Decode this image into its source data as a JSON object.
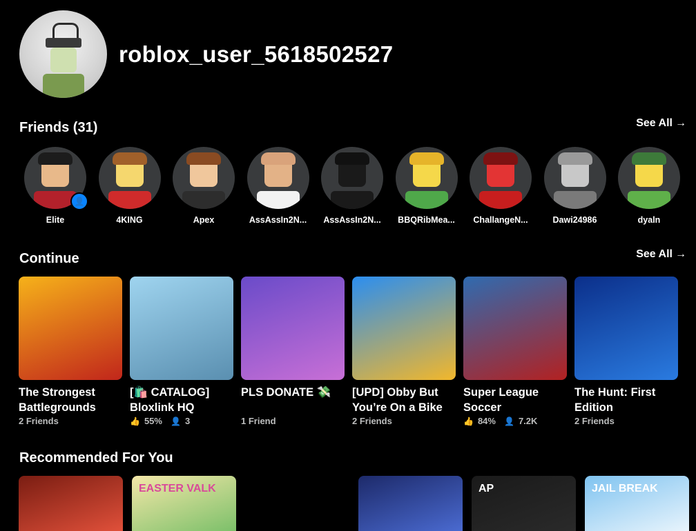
{
  "profile": {
    "username": "roblox_user_5618502527"
  },
  "friends": {
    "title": "Friends (31)",
    "see_all": "See All",
    "items": [
      {
        "name": "Elite",
        "hair": "#1c1c1c",
        "head": "#e8b98a",
        "body": "#b3212b",
        "online": true
      },
      {
        "name": "4KING",
        "hair": "#a0602a",
        "head": "#f5d76e",
        "body": "#d02b2b",
        "online": false
      },
      {
        "name": "Apex",
        "hair": "#8a4b22",
        "head": "#f0c79c",
        "body": "#2d2d2d",
        "online": false
      },
      {
        "name": "AssAssIn2N...",
        "hair": "#d9a37b",
        "head": "#e3b287",
        "body": "#f2f2f2",
        "online": false
      },
      {
        "name": "AssAssIn2N...",
        "hair": "#111111",
        "head": "#1a1a1a",
        "body": "#1a1a1a",
        "online": false
      },
      {
        "name": "BBQRibMea...",
        "hair": "#e6b42a",
        "head": "#f5d84a",
        "body": "#4fa84a",
        "online": false
      },
      {
        "name": "ChallangeN...",
        "hair": "#7d1212",
        "head": "#e33434",
        "body": "#c81e1e",
        "online": false
      },
      {
        "name": "Dawi24986",
        "hair": "#9a9a9a",
        "head": "#c8c8c8",
        "body": "#7a7a7a",
        "online": false
      },
      {
        "name": "dyaln",
        "hair": "#3d7a3a",
        "head": "#f5d84a",
        "body": "#5fb04a",
        "online": false
      }
    ]
  },
  "continue": {
    "title": "Continue",
    "see_all": "See All",
    "items": [
      {
        "title": "The Strongest Battlegrounds",
        "meta": "2 Friends",
        "rating": "",
        "players": "",
        "colors": [
          "#f6b21a",
          "#c1261b"
        ]
      },
      {
        "title": "[🛍️ CATALOG] Bloxlink HQ",
        "meta": "",
        "rating": "55%",
        "players": "3",
        "colors": [
          "#9fd4ef",
          "#5a8fb0"
        ]
      },
      {
        "title": "PLS DONATE 💸",
        "meta": "1 Friend",
        "rating": "",
        "players": "",
        "colors": [
          "#6a4bc9",
          "#c86fd6"
        ]
      },
      {
        "title": "[UPD] Obby But You’re On a Bike",
        "meta": "2 Friends",
        "rating": "",
        "players": "",
        "colors": [
          "#2b8ef0",
          "#f2b72b"
        ]
      },
      {
        "title": "Super League Soccer",
        "meta": "",
        "rating": "84%",
        "players": "7.2K",
        "colors": [
          "#2f6bb0",
          "#b32121"
        ]
      },
      {
        "title": "The Hunt: First Edition",
        "meta": "2 Friends",
        "rating": "",
        "players": "",
        "colors": [
          "#0b2f8a",
          "#2a7be0"
        ]
      }
    ]
  },
  "recommended": {
    "title": "Recommended For You",
    "items": [
      {
        "label": "",
        "colors": [
          "#7a1d12",
          "#e0503a"
        ]
      },
      {
        "label": "EASTER VALK",
        "colors": [
          "#f4e7a8",
          "#7cc06a"
        ]
      },
      {
        "label": "",
        "colors": [
          "#000000",
          "#000000"
        ]
      },
      {
        "label": "",
        "colors": [
          "#1d2a6a",
          "#4a6ad0"
        ]
      },
      {
        "label": "AP",
        "colors": [
          "#1a1a1a",
          "#2a2a2a"
        ]
      },
      {
        "label": "JAIL BREAK",
        "colors": [
          "#7fc3f0",
          "#e8f4fc"
        ]
      }
    ]
  }
}
